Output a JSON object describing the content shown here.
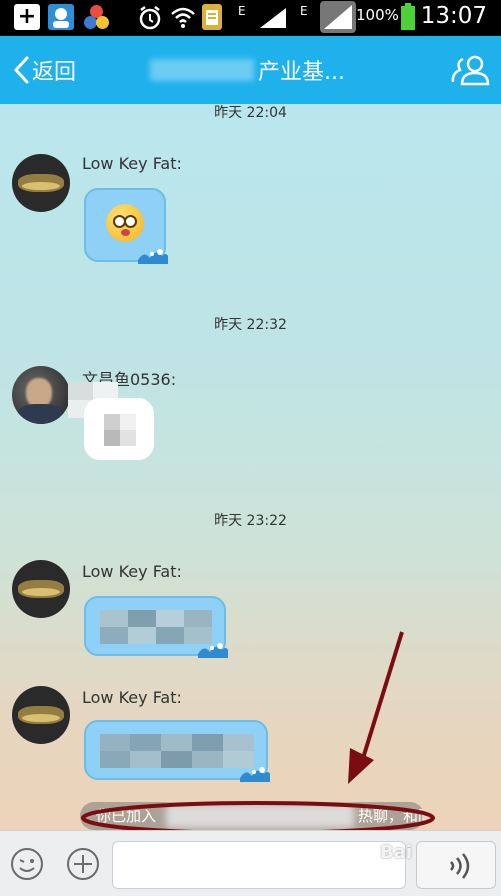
{
  "status_bar": {
    "network_label_1": "E",
    "network_label_2": "E",
    "battery_text": "100%",
    "time": "13:07"
  },
  "header": {
    "back_label": "返回",
    "title": "产业基..."
  },
  "messages": [
    {
      "time": "昨天 22:04",
      "sender": "Low Key Fat:"
    },
    {
      "time": "昨天 22:32",
      "sender": "文昌鱼0536:"
    },
    {
      "time": "昨天 23:22",
      "sender": "Low Key Fat:"
    },
    {
      "sender": "Low Key Fat:"
    }
  ],
  "notice": {
    "prefix": "你已加入",
    "suffix": "热聊，和同一位置"
  },
  "watermark": "Bai",
  "colors": {
    "header_bg": "#1eb1ec",
    "bubble_bg": "#8fd0f6",
    "annotation": "#7a0d12"
  }
}
